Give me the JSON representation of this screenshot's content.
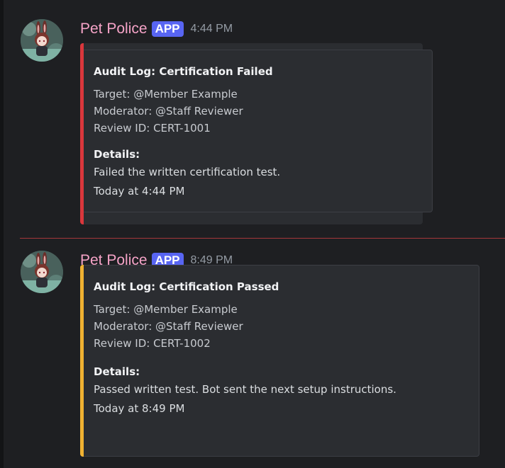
{
  "messages": [
    {
      "username": "Pet Police",
      "badge": "APP",
      "time": "4:44 PM",
      "embed": {
        "accent": "#da373c",
        "title": "Audit Log: Certification Failed",
        "target": "Target: @Member Example",
        "moderator": "Moderator: @Staff Reviewer",
        "review_id": "Review ID: CERT-1001",
        "details_label": "Details:",
        "details": "Failed the written certification test.",
        "footer": "Today at 4:44 PM"
      }
    },
    {
      "username": "Pet Police",
      "badge": "APP",
      "time": "8:49 PM",
      "embed": {
        "accent": "#f0b232",
        "title": "Audit Log: Certification Passed",
        "target": "Target: @Member Example",
        "moderator": "Moderator: @Staff Reviewer",
        "review_id": "Review ID: CERT-1002",
        "details_label": "Details:",
        "details": "Passed written test. Bot sent the next setup instructions.",
        "footer": "Today at 8:49 PM"
      }
    }
  ],
  "colors": {
    "background": "#1e1f22",
    "embed_bg": "#2b2d31",
    "username": "#f5a3c7",
    "badge": "#5865f2",
    "new_divider": "#a5383b"
  },
  "icons": {
    "avatar": "bunny-avatar-icon"
  }
}
